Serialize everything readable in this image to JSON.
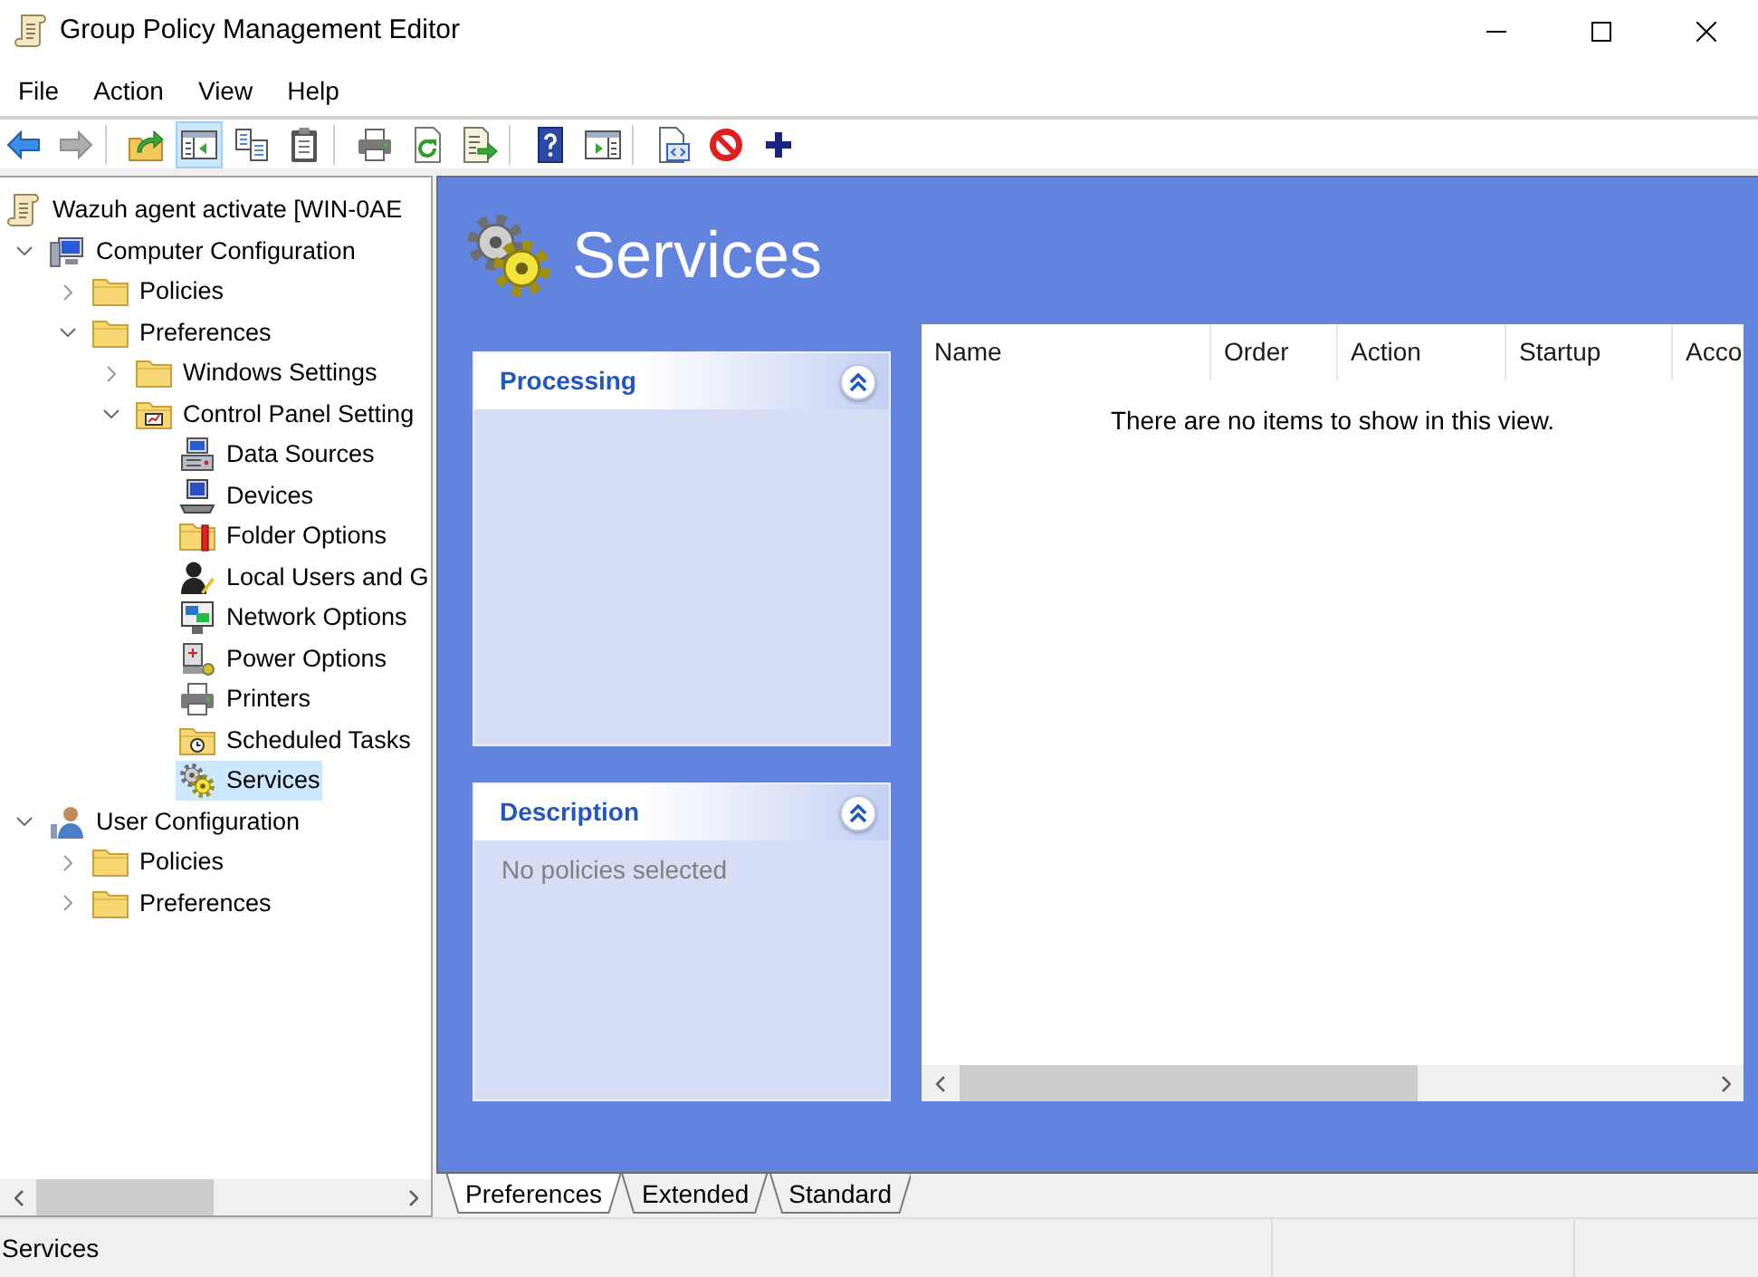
{
  "window": {
    "title": "Group Policy Management Editor"
  },
  "menu": [
    {
      "label": "File"
    },
    {
      "label": "Action"
    },
    {
      "label": "View"
    },
    {
      "label": "Help"
    }
  ],
  "toolbar": {
    "groups": [
      [
        {
          "kind": "back",
          "disabled": false,
          "pressed": false
        },
        {
          "kind": "forward",
          "disabled": true,
          "pressed": false
        }
      ],
      [
        {
          "kind": "up",
          "disabled": false,
          "pressed": false
        },
        {
          "kind": "tree",
          "disabled": false,
          "pressed": true
        },
        {
          "kind": "copy",
          "disabled": false,
          "pressed": false
        },
        {
          "kind": "paste",
          "disabled": false,
          "pressed": false
        }
      ],
      [
        {
          "kind": "print",
          "disabled": false,
          "pressed": false
        },
        {
          "kind": "refresh",
          "disabled": false,
          "pressed": false
        },
        {
          "kind": "export",
          "disabled": false,
          "pressed": false
        }
      ],
      [
        {
          "kind": "help",
          "disabled": false,
          "pressed": false
        },
        {
          "kind": "pane",
          "disabled": false,
          "pressed": false
        }
      ],
      [
        {
          "kind": "properties",
          "disabled": false,
          "pressed": false
        },
        {
          "kind": "stop",
          "disabled": false,
          "pressed": false
        },
        {
          "kind": "add",
          "disabled": false,
          "pressed": false
        }
      ]
    ]
  },
  "tree": {
    "root": {
      "label": "Wazuh agent activate [WIN-0AE",
      "kind": "policy",
      "selected": false,
      "children": [
        {
          "label": "Computer Configuration",
          "kind": "computer",
          "expanded": true,
          "selected": false,
          "children": [
            {
              "label": "Policies",
              "kind": "folder",
              "expanded": false,
              "selected": false
            },
            {
              "label": "Preferences",
              "kind": "folder",
              "expanded": true,
              "selected": false,
              "children": [
                {
                  "label": "Windows Settings",
                  "kind": "folder",
                  "expanded": false,
                  "selected": false
                },
                {
                  "label": "Control Panel Setting",
                  "kind": "panel",
                  "expanded": true,
                  "selected": false,
                  "children": [
                    {
                      "label": "Data Sources",
                      "kind": "datasource",
                      "selected": false
                    },
                    {
                      "label": "Devices",
                      "kind": "device",
                      "selected": false
                    },
                    {
                      "label": "Folder Options",
                      "kind": "folderopts",
                      "selected": false
                    },
                    {
                      "label": "Local Users and G",
                      "kind": "users",
                      "selected": false
                    },
                    {
                      "label": "Network Options",
                      "kind": "network",
                      "selected": false
                    },
                    {
                      "label": "Power Options",
                      "kind": "power",
                      "selected": false
                    },
                    {
                      "label": "Printers",
                      "kind": "printer",
                      "selected": false
                    },
                    {
                      "label": "Scheduled Tasks",
                      "kind": "tasks",
                      "selected": false
                    },
                    {
                      "label": "Services",
                      "kind": "services",
                      "selected": true
                    }
                  ]
                }
              ]
            }
          ]
        },
        {
          "label": "User Configuration",
          "kind": "user",
          "expanded": true,
          "selected": false,
          "children": [
            {
              "label": "Policies",
              "kind": "folder",
              "expanded": false,
              "selected": false
            },
            {
              "label": "Preferences",
              "kind": "folder",
              "expanded": false,
              "selected": false
            }
          ]
        }
      ]
    }
  },
  "details": {
    "heading": "Services",
    "panels": [
      {
        "title": "Processing",
        "expanded": true
      },
      {
        "title": "Description",
        "expanded": true,
        "text": "No policies selected"
      }
    ],
    "table": {
      "columns": [
        {
          "label": "Name"
        },
        {
          "label": "Order"
        },
        {
          "label": "Action"
        },
        {
          "label": "Startup"
        },
        {
          "label": "Acco"
        }
      ],
      "empty_message": "There are no items to show in this view."
    }
  },
  "view_tabs": [
    {
      "label": "Preferences",
      "selected": true
    },
    {
      "label": "Extended",
      "selected": false
    },
    {
      "label": "Standard",
      "selected": false
    }
  ],
  "status_bar": {
    "text": "Services"
  }
}
